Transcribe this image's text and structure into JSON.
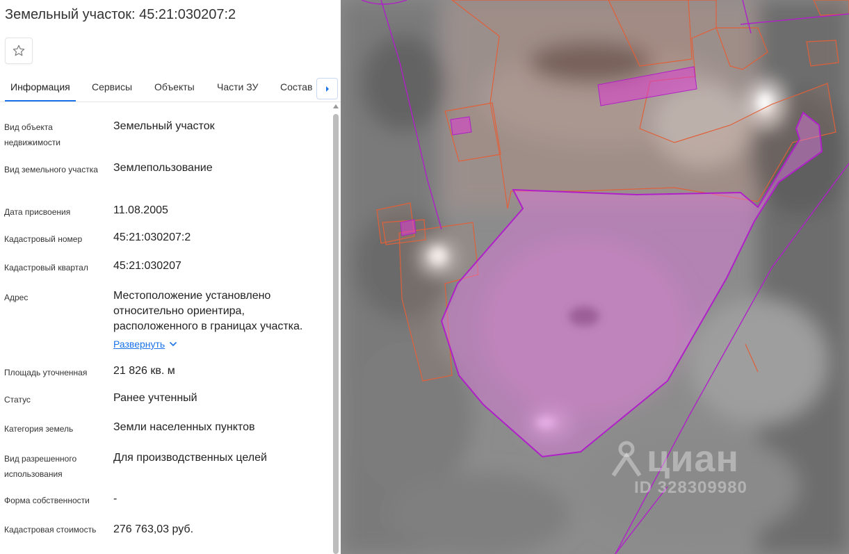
{
  "title": "Земельный участок: 45:21:030207:2",
  "tabs": [
    "Информация",
    "Сервисы",
    "Объекты",
    "Части ЗУ",
    "Состав"
  ],
  "active_tab": 0,
  "accent_color": "#1a73e8",
  "rows": [
    {
      "label": "Вид объекта недвижимости",
      "value": "Земельный участок"
    },
    {
      "label": "Вид земельного участка",
      "value": "Землепользование"
    },
    {
      "label": "Дата присвоения",
      "value": "11.08.2005"
    },
    {
      "label": "Кадастровый номер",
      "value": "45:21:030207:2"
    },
    {
      "label": "Кадастровый квартал",
      "value": "45:21:030207"
    },
    {
      "label": "Адрес",
      "value": "Местоположение установлено относительно ориентира, расположенного в границах участка.",
      "action": "Развернуть"
    },
    {
      "label": "Площадь уточненная",
      "value": "21 826 кв. м"
    },
    {
      "label": "Статус",
      "value": "Ранее учтенный"
    },
    {
      "label": "Категория земель",
      "value": "Земли населенных пунктов"
    },
    {
      "label": "Вид разрешенного использования",
      "value": "Для производственных целей"
    },
    {
      "label": "Форма собственности",
      "value": "-"
    },
    {
      "label": "Кадастровая стоимость",
      "value": "276 763,03 руб."
    }
  ],
  "watermark": {
    "brand": "циан",
    "id": "ID 328309980"
  },
  "map_colors": {
    "parcel_border": "#b020c8",
    "parcel_fill": "#e08ae0",
    "neighbor_border": "#e0603a"
  }
}
